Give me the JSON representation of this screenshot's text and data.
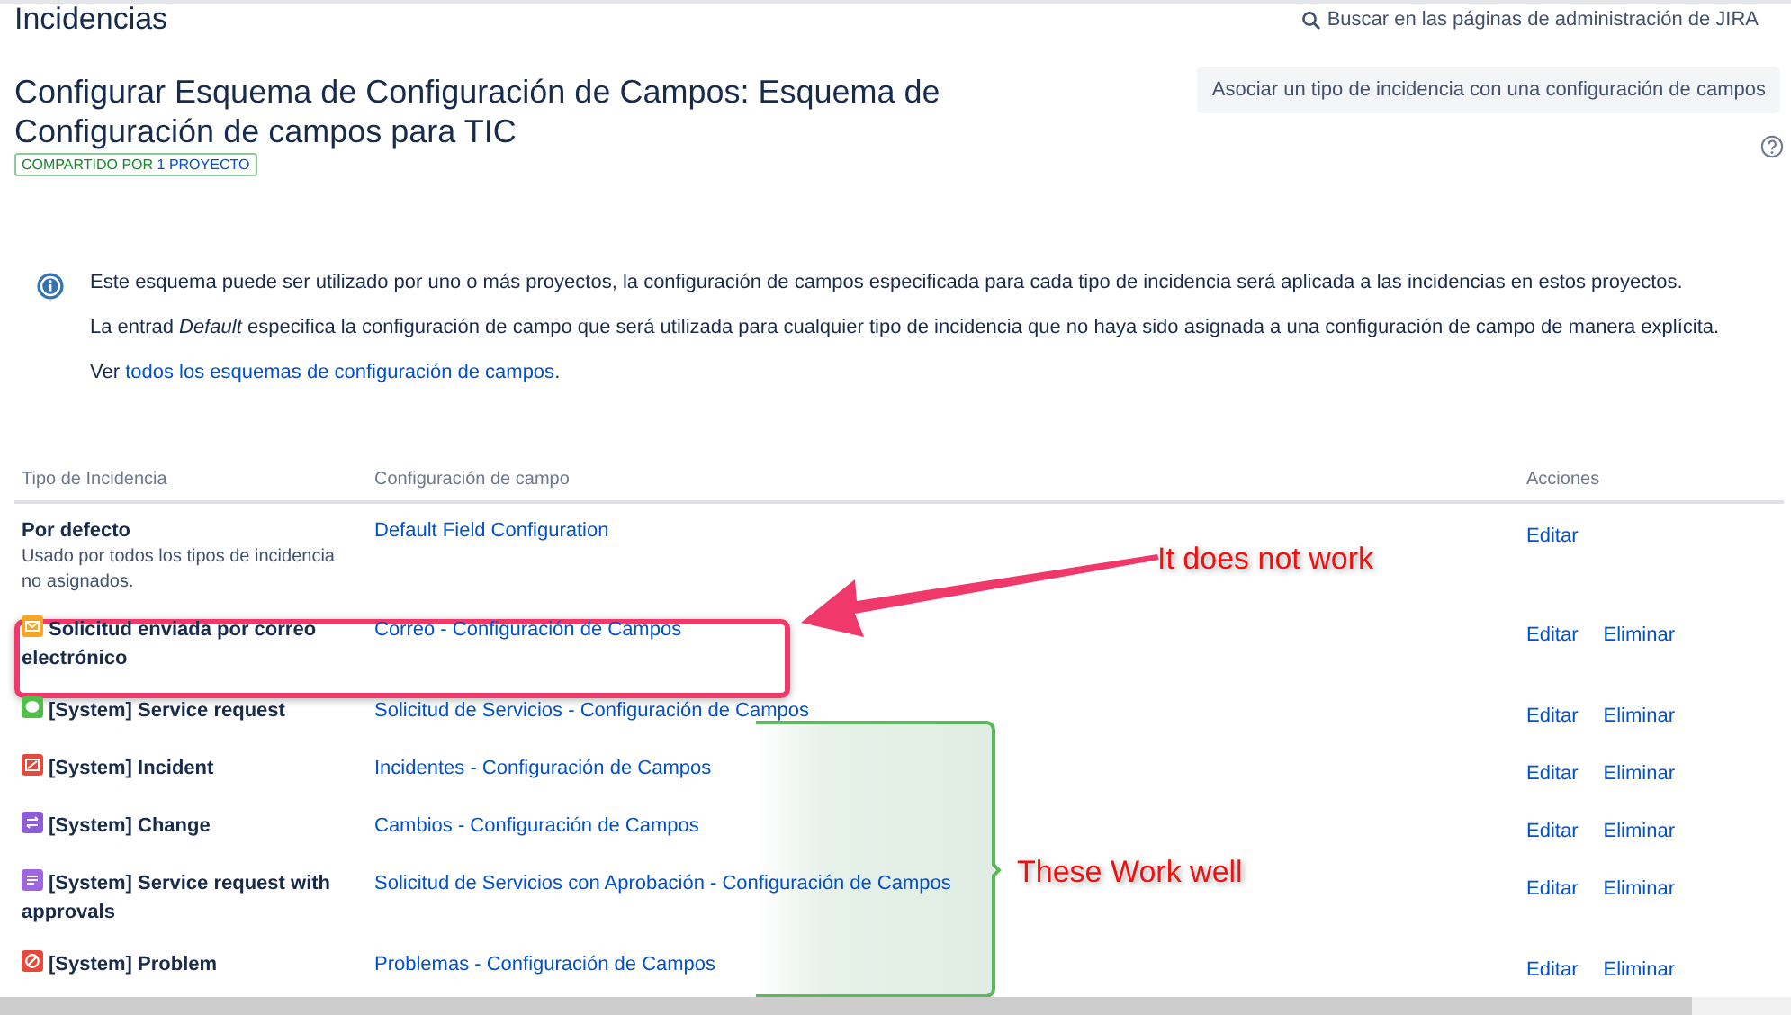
{
  "header": {
    "section": "Incidencias",
    "search_link": "Buscar en las páginas de administración de JIRA",
    "title": "Configurar Esquema de Configuración de Campos: Esquema de Configuración de campos para TIC",
    "shared_badge": "COMPARTIDO POR",
    "shared_count": "1 PROYECTO",
    "action_button": "Asociar un tipo de incidencia con una configuración de campos"
  },
  "info": {
    "paragraphs": [
      "Este esquema puede ser utilizado por uno o más proyectos, la configuración de campos especificada para cada tipo de incidencia será aplicada a las incidencias en estos proyectos.",
      "La entrad *Default* especifica la configuración de campo que será utilizada para cualquier tipo de incidencia que no haya sido asignada a una configuración de campo de manera explícita."
    ],
    "link_prefix": "Ver",
    "link": "todos los esquemas de configuración de campos",
    "link_suffix": "."
  },
  "table": {
    "columns": [
      "Tipo de Incidencia",
      "Configuración de campo",
      "Acciones"
    ],
    "rows": [
      {
        "kind": "default",
        "name": "Por defecto",
        "description": "Usado por todos los tipos de incidencia no asignados.",
        "configuration": "Default Field Configuration",
        "actions": [
          "Editar"
        ]
      },
      {
        "kind": "mail",
        "color": "#f6a623",
        "name": "Solicitud enviada por correo electrónico",
        "configuration": "Correo - Configuración de Campos",
        "actions": [
          "Editar",
          "Eliminar"
        ]
      },
      {
        "kind": "chat",
        "color": "#4fbf47",
        "name": "[System] Service request",
        "configuration": "Solicitud de Servicios - Configuración de Campos",
        "actions": [
          "Editar",
          "Eliminar"
        ]
      },
      {
        "kind": "incident",
        "color": "#e5493a",
        "name": "[System] Incident",
        "configuration": "Incidentes - Configuración de Campos",
        "actions": [
          "Editar",
          "Eliminar"
        ]
      },
      {
        "kind": "change",
        "color": "#8e5bd9",
        "name": "[System] Change",
        "configuration": "Cambios - Configuración de Campos",
        "actions": [
          "Editar",
          "Eliminar"
        ]
      },
      {
        "kind": "form",
        "color": "#a066e0",
        "name": "[System] Service request with approvals",
        "configuration": "Solicitud de Servicios con Aprobación - Configuración de Campos",
        "actions": [
          "Editar",
          "Eliminar"
        ]
      },
      {
        "kind": "problem",
        "color": "#e5493a",
        "name": "[System] Problem",
        "configuration": "Problemas - Configuración de Campos",
        "actions": [
          "Editar",
          "Eliminar"
        ]
      }
    ]
  },
  "annotations": [
    {
      "kind": "callout",
      "text": "It does not work"
    },
    {
      "kind": "bracket",
      "text": "These Work well"
    }
  ]
}
